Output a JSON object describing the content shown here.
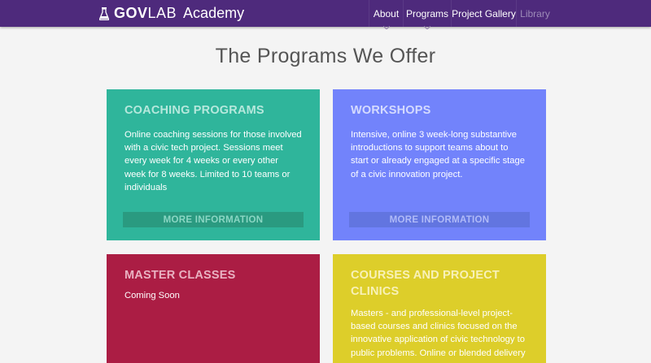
{
  "brand": {
    "name_bold": "GOV",
    "name_light": "LAB",
    "suffix": "Academy",
    "icon": "flask-icon"
  },
  "nav": {
    "items": [
      {
        "label": "About",
        "has_caret": true
      },
      {
        "label": "Programs",
        "has_caret": true
      },
      {
        "label": "Project Gallery"
      },
      {
        "label": "Library",
        "muted": true
      }
    ]
  },
  "page": {
    "title": "The Programs We Offer"
  },
  "cards": [
    {
      "title": "COACHING PROGRAMS",
      "description": "Online coaching sessions for those involved with a civic tech project. Sessions meet every week for 4 weeks or every other week for 8 weeks. Limited to 10 teams or individuals",
      "button": "MORE INFORMATION",
      "color": "#2fb59b"
    },
    {
      "title": "WORKSHOPS",
      "description": "Intensive, online 3 week-long substantive introductions to support teams about to start or already engaged at a specific stage of a civic innovation project.",
      "button": "MORE INFORMATION",
      "color": "#7283fb"
    },
    {
      "title": "MASTER CLASSES",
      "description": "Coming Soon",
      "color": "#ab1d44"
    },
    {
      "title": "COURSES AND PROJECT CLINICS",
      "description": "Masters - and professional-level project-based courses and clinics focused on the innovative application of civic technology to public problems. Online or blended delivery",
      "color": "#ddce2a"
    }
  ],
  "colors": {
    "nav_bg": "#4e2a7c",
    "page_bg": "#f4f4f4"
  }
}
